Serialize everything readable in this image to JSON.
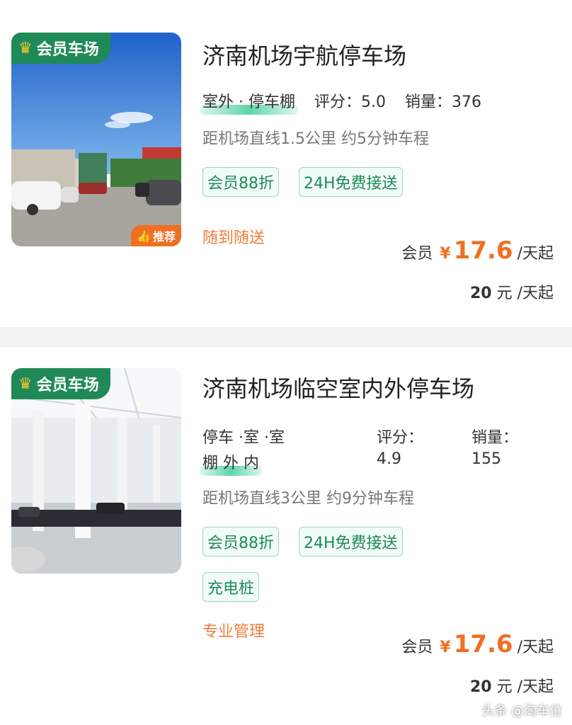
{
  "listings": [
    {
      "badge": "会员车场",
      "recommend": "推荐",
      "title": "济南机场宇航停车场",
      "type": "室外 · 停车棚",
      "rating_label": "评分：",
      "rating": "5.0",
      "sales_label": "销量：",
      "sales": "376",
      "distance": "距机场直线1.5公里 约5分钟车程",
      "tags": [
        "会员88折",
        "24H免费接送"
      ],
      "service": "随到随送",
      "member_label": "会员",
      "currency": "¥",
      "member_price": "17.6",
      "unit": "/天起",
      "original_price": "20",
      "original_unit": "元 /天起"
    },
    {
      "badge": "会员车场",
      "title": "济南机场临空室内外停车场",
      "type_line1": "停车 ·室 ·室",
      "type_line2": "棚 外 内",
      "rating_label": "评分：",
      "rating": "4.9",
      "sales_label": "销量：",
      "sales": "155",
      "distance": "距机场直线3公里 约9分钟车程",
      "tags": [
        "会员88折",
        "24H免费接送",
        "充电桩"
      ],
      "service": "专业管理",
      "member_label": "会员",
      "currency": "¥",
      "member_price": "17.6",
      "unit": "/天起",
      "original_price": "20",
      "original_unit": "元 /天起"
    }
  ],
  "watermark": "头条 @淘车位",
  "colors": {
    "accent_green": "#1f8a58",
    "price_orange": "#f06f21",
    "service_orange": "#f07d3c"
  },
  "icons": {
    "crown": "crown-icon",
    "thumbs_up": "thumbs-up-icon"
  }
}
